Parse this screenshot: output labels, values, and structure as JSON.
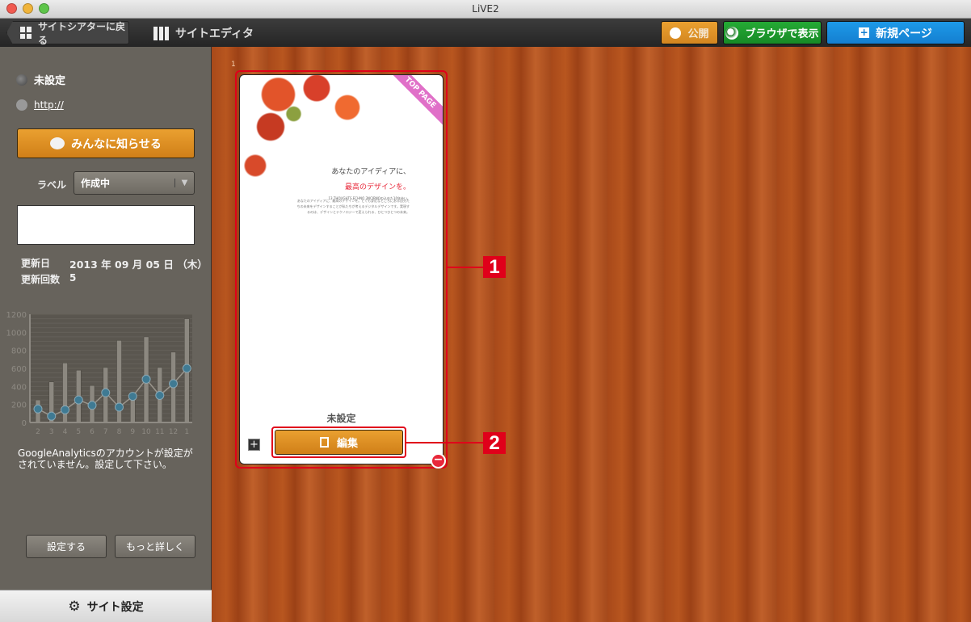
{
  "window": {
    "title": "LiVE2"
  },
  "toolbar": {
    "back_label": "サイトシアターに戻る",
    "editor_title": "サイトエディタ",
    "publish_label": "公開",
    "browser_label": "ブラウザで表示",
    "new_page_label": "新規ページ"
  },
  "sidebar": {
    "site_name": "未設定",
    "url": "http://",
    "announce_label": "みんなに知らせる",
    "label_caption": "ラベル",
    "label_value": "作成中",
    "memo_value": "",
    "updated_label": "更新日",
    "updated_value": "2013 年 09 月 05 日 （木）",
    "update_count_label": "更新回数",
    "update_count_value": "5",
    "analytics_message": "GoogleAnalyticsのアカウントが設定がされていません。設定して下さい。",
    "setup_label": "設定する",
    "more_label": "もっと詳しく",
    "site_settings_label": "サイト設定"
  },
  "chart_data": {
    "type": "bar",
    "categories": [
      "2",
      "3",
      "4",
      "5",
      "6",
      "7",
      "8",
      "9",
      "10",
      "11",
      "12",
      "1"
    ],
    "series": [
      {
        "type": "bar",
        "values": [
          250,
          450,
          660,
          580,
          410,
          610,
          910,
          290,
          950,
          610,
          780,
          1150
        ]
      },
      {
        "type": "line",
        "values": [
          150,
          70,
          140,
          250,
          190,
          330,
          170,
          290,
          480,
          300,
          430,
          600
        ]
      }
    ],
    "yticks": [
      "0",
      "200",
      "400",
      "600",
      "800",
      "1000",
      "1200"
    ],
    "ylim": [
      0,
      1200
    ],
    "grid": true,
    "colors": {
      "bar": "#8c8880",
      "line": "#9a958c",
      "point": "#3f7a93"
    }
  },
  "page_card": {
    "index": "1",
    "badge": "TOP PAGE",
    "headline": "あなたのアイディアに、",
    "headline_accent": "最高のデザインを。",
    "subline": "13 THOUGHTS ECHNO 3NCIBNOの込めた10年歩い。",
    "body": "あなたのアイディアに、最高のデザインを。とても身近なところにある自分たちの未来をデザインすることが私たちが考えるデジタルデザインです。実現するのは、デザインとテクノロジーで変えられる、ひとつひとつの未来。",
    "page_name": "未設定",
    "edit_label": "編集"
  },
  "callouts": [
    "1",
    "2"
  ],
  "colors": {
    "accent_red": "#e0001a",
    "publish": "#e39a2a",
    "browser": "#1e9a2e",
    "new_page": "#1a8fe0"
  }
}
